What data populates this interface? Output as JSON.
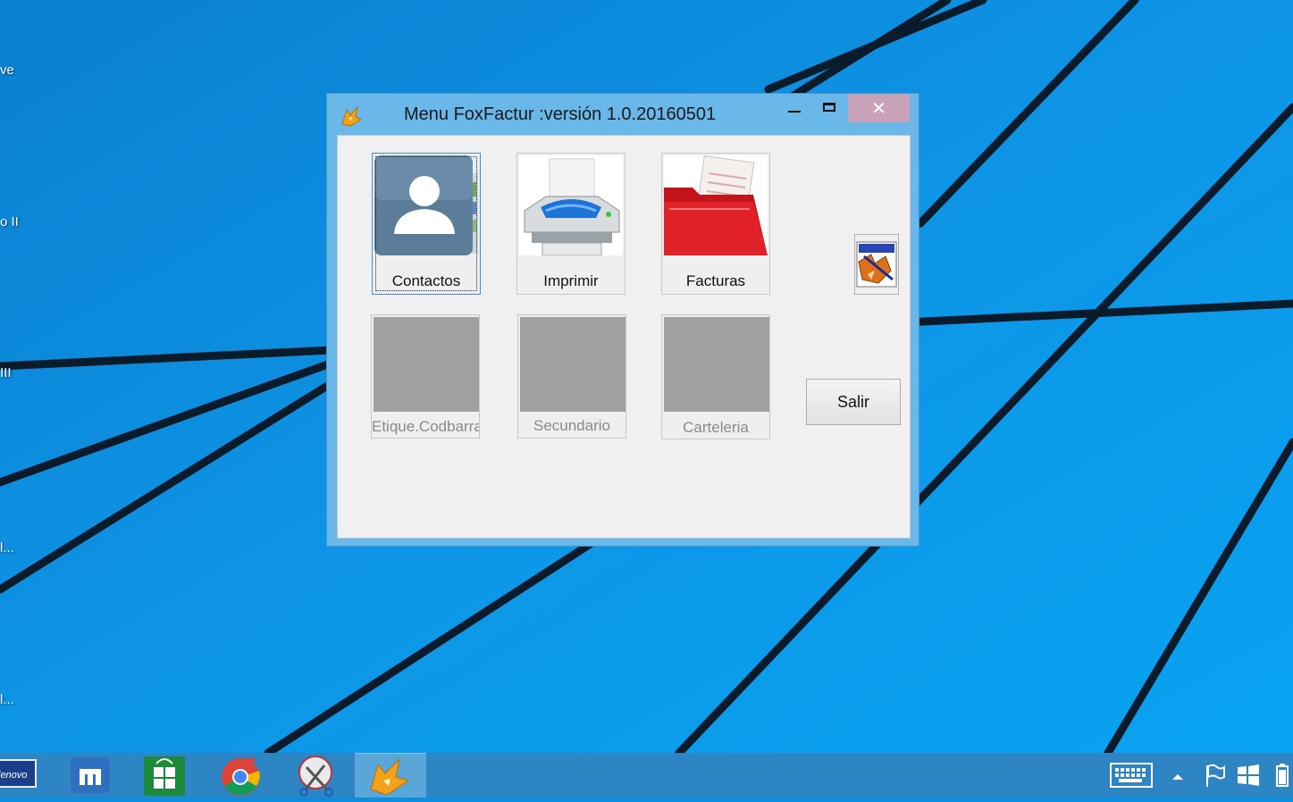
{
  "desktop": {
    "labels": [
      "ve",
      "o II",
      "III",
      "l...",
      "l..."
    ]
  },
  "window": {
    "title": "Menu FoxFactur :versión 1.0.20160501",
    "close_glyph": "✕",
    "buttons": [
      {
        "label": "Contactos",
        "icon": "contacts-icon",
        "enabled": true,
        "focused": true
      },
      {
        "label": "Imprimir",
        "icon": "printer-icon",
        "enabled": true
      },
      {
        "label": "Facturas",
        "icon": "invoice-folder-icon",
        "enabled": true
      },
      {
        "label": "Etique.Codbarra",
        "icon": "blank-image",
        "enabled": false
      },
      {
        "label": "Secundario",
        "icon": "blank-image",
        "enabled": false
      },
      {
        "label": "Carteleria",
        "icon": "blank-image",
        "enabled": false
      }
    ],
    "exit_label": "Salir"
  },
  "taskbar": {
    "apps": [
      "lenovo-icon",
      "maxthon-icon",
      "store-icon",
      "chrome-icon",
      "snipping-tool-icon",
      "foxpro-icon"
    ],
    "tray": [
      "keyboard-icon",
      "chevron-up-icon",
      "flag-icon",
      "windows-icon",
      "battery-icon"
    ]
  },
  "colors": {
    "desktop": "#0a8fe0",
    "window_frame": "#6ab7ea",
    "close_button": "#c7a2b9",
    "taskbar": "#2d86c3"
  }
}
